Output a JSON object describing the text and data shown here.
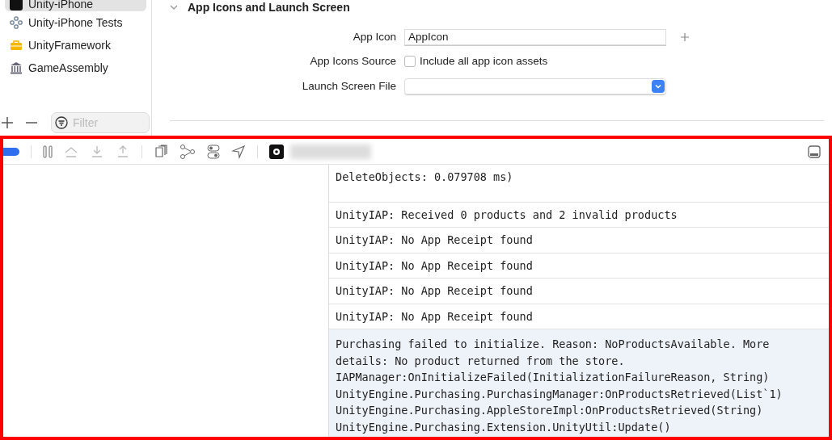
{
  "sidebar": {
    "items": [
      {
        "label": "Unity-iPhone",
        "kind": "app",
        "selected": true
      },
      {
        "label": "Unity-iPhone Tests",
        "kind": "tests",
        "selected": false
      },
      {
        "label": "UnityFramework",
        "kind": "framework",
        "selected": false
      },
      {
        "label": "GameAssembly",
        "kind": "library",
        "selected": false
      }
    ],
    "filter": {
      "placeholder": "Filter"
    }
  },
  "section": {
    "title": "App Icons and Launch Screen",
    "expanded": true,
    "app_icon": {
      "label": "App Icon",
      "value": "AppIcon"
    },
    "app_icons_source": {
      "label": "App Icons Source",
      "checkbox_label": "Include all app icon assets",
      "checked": false
    },
    "launch_screen_file": {
      "label": "Launch Screen File"
    }
  },
  "debug_toolbar": {
    "breakpoints_on": true
  },
  "console": {
    "entries": [
      {
        "text": "DeleteObjects: 0.079708 ms)",
        "selected": false
      },
      {
        "text": "UnityIAP: Received 0 products and 2 invalid products",
        "selected": false
      },
      {
        "text": "UnityIAP: No App Receipt found",
        "selected": false
      },
      {
        "text": "UnityIAP: No App Receipt found",
        "selected": false
      },
      {
        "text": "UnityIAP: No App Receipt found",
        "selected": false
      },
      {
        "text": "UnityIAP: No App Receipt found",
        "selected": false
      },
      {
        "text": "Purchasing failed to initialize. Reason: NoProductsAvailable. More details: No product returned from the store.\nIAPManager:OnInitializeFailed(InitializationFailureReason, String)\nUnityEngine.Purchasing.PurchasingManager:OnProductsRetrieved(List`1)\nUnityEngine.Purchasing.AppleStoreImpl:OnProductsRetrieved(String)\nUnityEngine.Purchasing.Extension.UnityUtil:Update()",
        "selected": true
      }
    ]
  }
}
